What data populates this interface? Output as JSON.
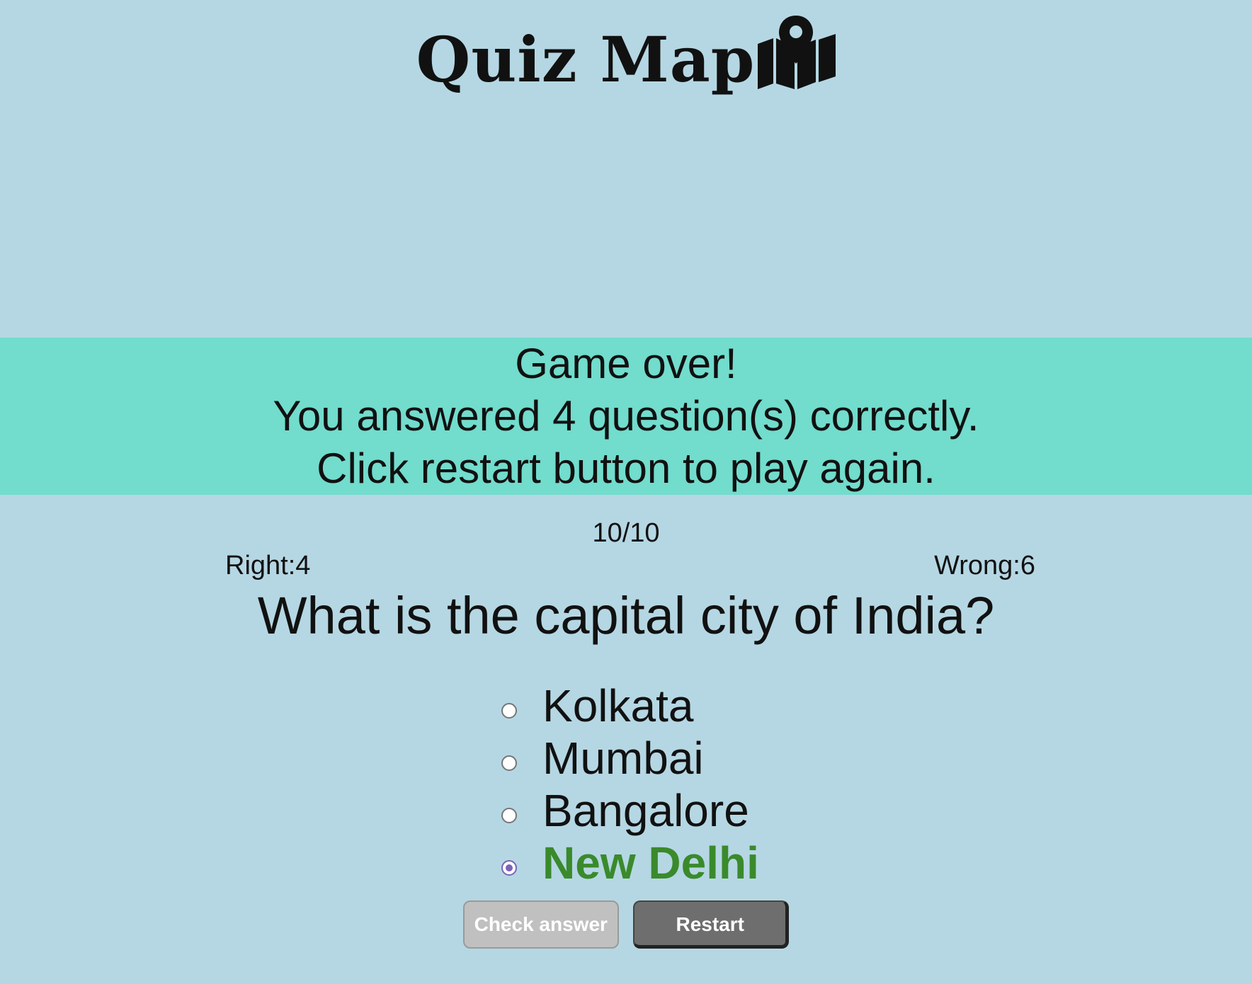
{
  "header": {
    "title": "Quiz Map",
    "icon": "map-pin-icon"
  },
  "banner": {
    "line1": "Game over!",
    "line2": "You answered 4 question(s) correctly.",
    "line3": "Click restart button to play again.",
    "background": "#72dccd"
  },
  "progress": {
    "counter": "10/10"
  },
  "score": {
    "right": "Right:4",
    "wrong": "Wrong:6"
  },
  "question": {
    "text": "What is the capital city of India?",
    "options": [
      {
        "label": "Kolkata",
        "selected": false,
        "correct": false
      },
      {
        "label": "Mumbai",
        "selected": false,
        "correct": false
      },
      {
        "label": "Bangalore",
        "selected": false,
        "correct": false
      },
      {
        "label": "New Delhi",
        "selected": true,
        "correct": true
      }
    ]
  },
  "buttons": {
    "check_label": "Check answer",
    "restart_label": "Restart"
  },
  "colors": {
    "page_background": "#b5d7e3",
    "correct_text": "#3a8a2c",
    "check_button": "#c0c0c0",
    "restart_button": "#6e6e6e"
  }
}
